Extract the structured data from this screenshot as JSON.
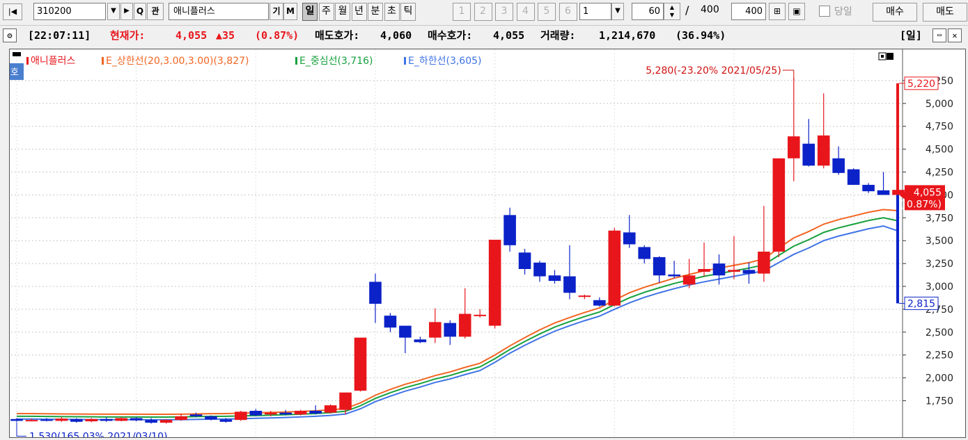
{
  "toolbar": {
    "code": "310200",
    "name": "애니플러스",
    "icon_labels": {
      "search": "Q",
      "gwan": "관",
      "gi": "기",
      "m": "M"
    },
    "periods": [
      "일",
      "주",
      "월",
      "년",
      "분",
      "초",
      "틱"
    ],
    "selected_period": "일",
    "minute_buttons": [
      "1",
      "2",
      "3",
      "4",
      "5",
      "6"
    ],
    "minute_select": "1",
    "count": "60",
    "slash": "/",
    "total": "400",
    "total_box": "400",
    "today_label": "당일",
    "buy_button": "매수",
    "sell_button": "매도"
  },
  "info": {
    "time": "[22:07:11]",
    "price_label": "현재가:",
    "price": "4,055",
    "change": "▲35",
    "change_pct": "(0.87%)",
    "ask_label": "매도호가:",
    "ask": "4,060",
    "bid_label": "매수호가:",
    "bid": "4,055",
    "volume_label": "거래량:",
    "volume": "1,214,670",
    "volume_pct": "(36.94%)",
    "period_badge": "[일]"
  },
  "legend": {
    "ho": "호",
    "name": "애니플러스",
    "upper": "E_상한선(20,3.00,3.00)(3,827)",
    "middle": "E_중심선(3,716)",
    "lower": "E_하한선(3,605)"
  },
  "colors": {
    "up": "#e8161b",
    "down": "#0b22c8",
    "upper": "#f26522",
    "middle": "#16a03c",
    "lower": "#3f73e6"
  },
  "chart_data": {
    "type": "candlestick",
    "ylim": [
      1450,
      5500
    ],
    "yticks": [
      1750,
      2000,
      2250,
      2500,
      2750,
      3000,
      3250,
      3500,
      3750,
      4000,
      4250,
      4500,
      4750,
      5000,
      5250
    ],
    "ytick_labels": [
      "1,750",
      "2,000",
      "2,250",
      "2,500",
      "2,750",
      "3,000",
      "3,250",
      "3,500",
      "3,750",
      "4,000",
      "4,250",
      "4,500",
      "4,750",
      "5,000",
      "5,250"
    ],
    "candles": [
      [
        1550,
        1560,
        1520,
        1530
      ],
      [
        1535,
        1555,
        1525,
        1540
      ],
      [
        1545,
        1560,
        1525,
        1530
      ],
      [
        1530,
        1570,
        1520,
        1555
      ],
      [
        1550,
        1560,
        1510,
        1520
      ],
      [
        1525,
        1560,
        1515,
        1550
      ],
      [
        1550,
        1570,
        1520,
        1530
      ],
      [
        1530,
        1570,
        1525,
        1560
      ],
      [
        1560,
        1570,
        1525,
        1535
      ],
      [
        1540,
        1560,
        1500,
        1510
      ],
      [
        1510,
        1550,
        1500,
        1540
      ],
      [
        1540,
        1610,
        1530,
        1580
      ],
      [
        1600,
        1620,
        1570,
        1580
      ],
      [
        1580,
        1590,
        1535,
        1545
      ],
      [
        1545,
        1560,
        1510,
        1520
      ],
      [
        1540,
        1640,
        1530,
        1630
      ],
      [
        1640,
        1660,
        1580,
        1590
      ],
      [
        1600,
        1640,
        1580,
        1620
      ],
      [
        1620,
        1650,
        1590,
        1600
      ],
      [
        1600,
        1650,
        1590,
        1640
      ],
      [
        1640,
        1700,
        1600,
        1610
      ],
      [
        1620,
        1710,
        1610,
        1700
      ],
      [
        1650,
        1820,
        1600,
        1840
      ],
      [
        1860,
        1880,
        1850,
        2440
      ],
      [
        3050,
        3140,
        2600,
        2810
      ],
      [
        2680,
        2710,
        2500,
        2550
      ],
      [
        2570,
        2570,
        2270,
        2440
      ],
      [
        2420,
        2450,
        2380,
        2390
      ],
      [
        2440,
        2760,
        2380,
        2610
      ],
      [
        2600,
        2630,
        2360,
        2450
      ],
      [
        2450,
        2980,
        2430,
        2700
      ],
      [
        2680,
        2750,
        2660,
        2690
      ],
      [
        2570,
        3240,
        2540,
        3510
      ],
      [
        3780,
        3860,
        3380,
        3450
      ],
      [
        3370,
        3410,
        3130,
        3190
      ],
      [
        3260,
        3280,
        3050,
        3110
      ],
      [
        3120,
        3180,
        3030,
        3060
      ],
      [
        3110,
        3450,
        2860,
        2930
      ],
      [
        2900,
        2910,
        2860,
        2900
      ],
      [
        2850,
        2880,
        2780,
        2790
      ],
      [
        2790,
        3640,
        2780,
        3610
      ],
      [
        3590,
        3780,
        3420,
        3460
      ],
      [
        3430,
        3450,
        3250,
        3300
      ],
      [
        3320,
        3330,
        3040,
        3120
      ],
      [
        3130,
        3280,
        3090,
        3110
      ],
      [
        3020,
        3300,
        2980,
        3120
      ],
      [
        3160,
        3480,
        3110,
        3190
      ],
      [
        3250,
        3350,
        3020,
        3120
      ],
      [
        3160,
        3550,
        3080,
        3180
      ],
      [
        3180,
        3260,
        3030,
        3140
      ],
      [
        3140,
        3880,
        3050,
        3380
      ],
      [
        3380,
        3400,
        3320,
        4400
      ],
      [
        4400,
        5280,
        4150,
        4640
      ],
      [
        4560,
        4830,
        4310,
        4320
      ],
      [
        4320,
        5110,
        4290,
        4650
      ],
      [
        4400,
        4530,
        4220,
        4240
      ],
      [
        4280,
        4290,
        4170,
        4110
      ],
      [
        4110,
        4130,
        4020,
        4040
      ],
      [
        4050,
        4250,
        4020,
        4000
      ],
      [
        4000,
        4050,
        4020,
        4055
      ]
    ],
    "upper_band": [
      1610,
      1610,
      1608,
      1606,
      1605,
      1604,
      1603,
      1603,
      1603,
      1602,
      1602,
      1603,
      1606,
      1609,
      1610,
      1614,
      1618,
      1622,
      1627,
      1633,
      1640,
      1650,
      1665,
      1727,
      1810,
      1874,
      1930,
      1975,
      2025,
      2065,
      2115,
      2160,
      2250,
      2350,
      2440,
      2525,
      2600,
      2660,
      2715,
      2765,
      2850,
      2930,
      2990,
      3040,
      3090,
      3130,
      3170,
      3200,
      3230,
      3260,
      3300,
      3420,
      3530,
      3600,
      3680,
      3730,
      3770,
      3810,
      3840,
      3827
    ],
    "middle_band": [
      1580,
      1580,
      1578,
      1576,
      1575,
      1574,
      1573,
      1573,
      1573,
      1572,
      1572,
      1573,
      1576,
      1579,
      1580,
      1584,
      1588,
      1592,
      1597,
      1603,
      1610,
      1620,
      1635,
      1695,
      1775,
      1838,
      1893,
      1938,
      1988,
      2026,
      2076,
      2120,
      2210,
      2310,
      2398,
      2480,
      2555,
      2615,
      2670,
      2720,
      2800,
      2875,
      2935,
      2985,
      3032,
      3072,
      3110,
      3140,
      3170,
      3200,
      3235,
      3340,
      3440,
      3510,
      3590,
      3640,
      3680,
      3720,
      3750,
      3716
    ],
    "lower_band": [
      1550,
      1550,
      1548,
      1546,
      1545,
      1544,
      1543,
      1543,
      1543,
      1542,
      1542,
      1543,
      1546,
      1549,
      1550,
      1554,
      1558,
      1562,
      1567,
      1573,
      1580,
      1590,
      1605,
      1662,
      1740,
      1800,
      1855,
      1900,
      1950,
      1988,
      2036,
      2080,
      2170,
      2270,
      2356,
      2436,
      2510,
      2570,
      2625,
      2675,
      2750,
      2820,
      2880,
      2930,
      2975,
      3015,
      3050,
      3080,
      3110,
      3140,
      3170,
      3260,
      3350,
      3420,
      3500,
      3550,
      3590,
      3630,
      3660,
      3605
    ],
    "annotations": {
      "high": "5,280(-23.20% 2021/05/25)",
      "low": "1,530(165.03% 2021/03/10)",
      "scale_high": "5,220",
      "scale_low": "2,815",
      "last_price": "4,055",
      "last_pct": "( 0.87%)"
    },
    "scale_bar": {
      "top": 5220,
      "bottom": 2815,
      "mid": 4000
    }
  }
}
